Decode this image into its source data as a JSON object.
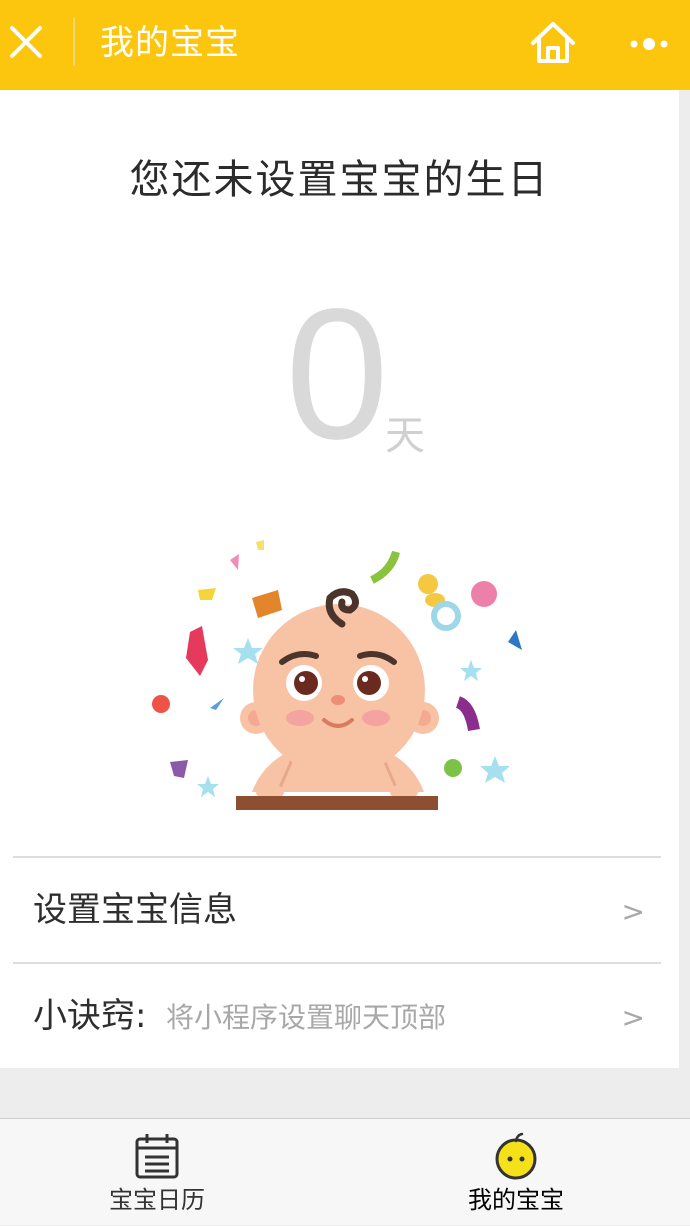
{
  "navbar": {
    "title": "我的宝宝",
    "icons": {
      "close": "close-icon",
      "home": "home-icon",
      "more": "more-icon"
    },
    "background_color": "#fdc60e"
  },
  "birthday": {
    "message": "您还未设置宝宝的生日",
    "day_count": "0",
    "day_unit": "天"
  },
  "menu": {
    "items": [
      {
        "label": "设置宝宝信息",
        "subtext": "",
        "arrow": ">"
      },
      {
        "label": "小诀窍:",
        "subtext": "将小程序设置聊天顶部",
        "arrow": ">"
      }
    ]
  },
  "tabbar": {
    "tabs": [
      {
        "label": "宝宝日历",
        "icon": "calendar-icon",
        "selected": false
      },
      {
        "label": "我的宝宝",
        "icon": "baby-face-icon",
        "selected": true
      }
    ]
  }
}
